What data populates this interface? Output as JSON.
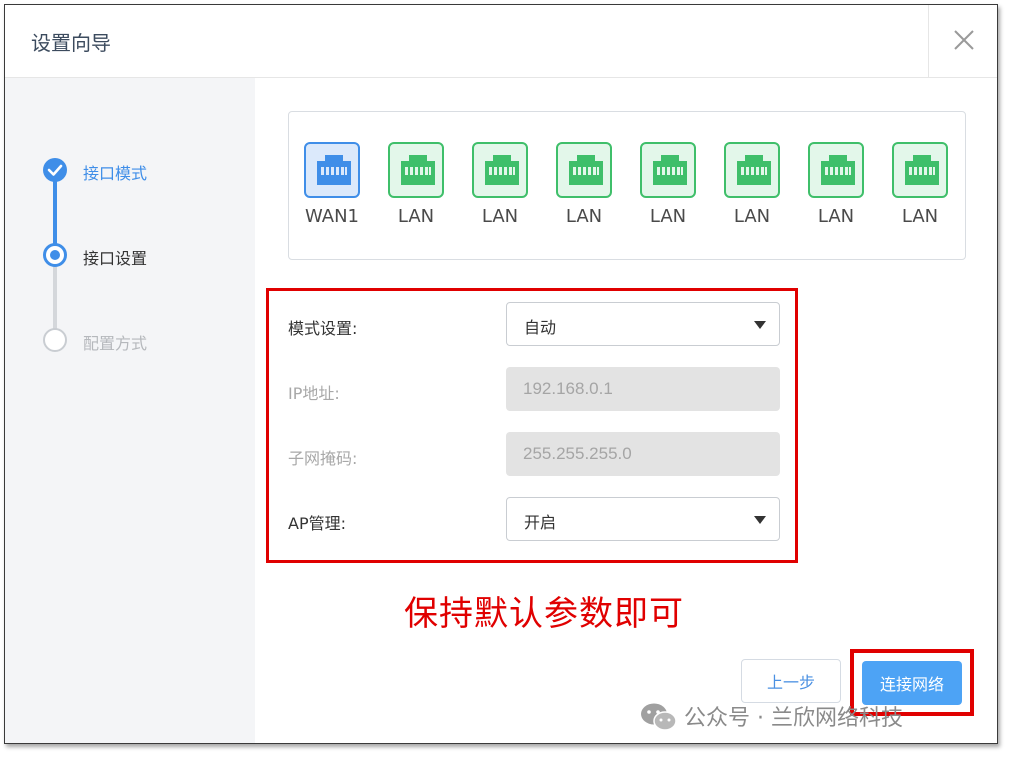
{
  "dialog": {
    "title": "设置向导",
    "close_icon": "close-icon"
  },
  "steps": [
    {
      "label": "接口模式",
      "state": "done"
    },
    {
      "label": "接口设置",
      "state": "current"
    },
    {
      "label": "配置方式",
      "state": "pending"
    }
  ],
  "ports": [
    {
      "label": "WAN1",
      "type": "wan"
    },
    {
      "label": "LAN",
      "type": "lan"
    },
    {
      "label": "LAN",
      "type": "lan"
    },
    {
      "label": "LAN",
      "type": "lan"
    },
    {
      "label": "LAN",
      "type": "lan"
    },
    {
      "label": "LAN",
      "type": "lan"
    },
    {
      "label": "LAN",
      "type": "lan"
    },
    {
      "label": "LAN",
      "type": "lan"
    }
  ],
  "form": {
    "mode": {
      "label": "模式设置:",
      "value": "自动"
    },
    "ip": {
      "label": "IP地址:",
      "value": "192.168.0.1"
    },
    "mask": {
      "label": "子网掩码:",
      "value": "255.255.255.0"
    },
    "ap": {
      "label": "AP管理:",
      "value": "开启"
    }
  },
  "annotation": "保持默认参数即可",
  "buttons": {
    "prev": "上一步",
    "next": "连接网络"
  },
  "watermark": "公众号 · 兰欣网络科技",
  "colors": {
    "accent": "#4da3f5",
    "wan_port": "#3f8ee8",
    "lan_port": "#3fbf6a",
    "highlight": "#e00000"
  }
}
